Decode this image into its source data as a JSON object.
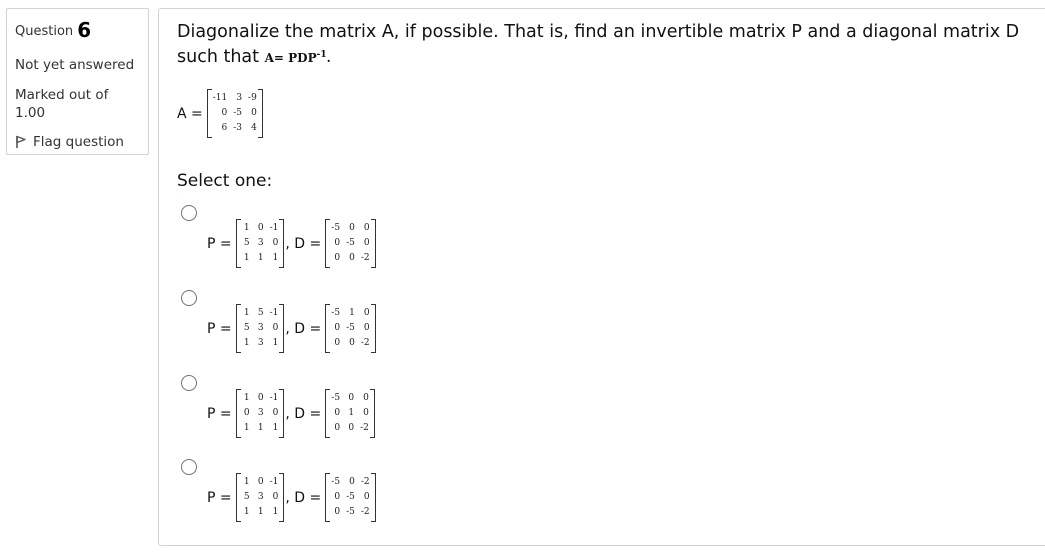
{
  "info": {
    "question_label": "Question",
    "question_number": "6",
    "state": "Not yet answered",
    "grade": "Marked out of 1.00",
    "flag_label": "Flag question",
    "flag_icon": "flag-icon"
  },
  "question": {
    "text": "Diagonalize the matrix A, if possible. That is, find an invertible matrix P and a diagonal matrix D such that ",
    "formula": "A= PDP",
    "formula_sup": "-1",
    "formula_end": ".",
    "a_label": "A =",
    "a_matrix": [
      "-11",
      "3",
      "-9",
      "0",
      "-5",
      "0",
      "6",
      "-3",
      "4"
    ]
  },
  "select_one": "Select one:",
  "options": [
    {
      "p_label": "P =",
      "p": [
        "1",
        "0",
        "-1",
        "5",
        "3",
        "0",
        "1",
        "1",
        "1"
      ],
      "d_label": ", D =",
      "d": [
        "-5",
        "0",
        "0",
        "0",
        "-5",
        "0",
        "0",
        "0",
        "-2"
      ]
    },
    {
      "p_label": "P =",
      "p": [
        "1",
        "5",
        "-1",
        "5",
        "3",
        "0",
        "1",
        "3",
        "1"
      ],
      "d_label": ", D =",
      "d": [
        "-5",
        "1",
        "0",
        "0",
        "-5",
        "0",
        "0",
        "0",
        "-2"
      ]
    },
    {
      "p_label": "P =",
      "p": [
        "1",
        "0",
        "-1",
        "0",
        "3",
        "0",
        "1",
        "1",
        "1"
      ],
      "d_label": ", D =",
      "d": [
        "-5",
        "0",
        "0",
        "0",
        "1",
        "0",
        "0",
        "0",
        "-2"
      ]
    },
    {
      "p_label": "P =",
      "p": [
        "1",
        "0",
        "-1",
        "5",
        "3",
        "0",
        "1",
        "1",
        "1"
      ],
      "d_label": ", D =",
      "d": [
        "-5",
        "0",
        "-2",
        "0",
        "-5",
        "0",
        "0",
        "-5",
        "-2"
      ]
    }
  ]
}
